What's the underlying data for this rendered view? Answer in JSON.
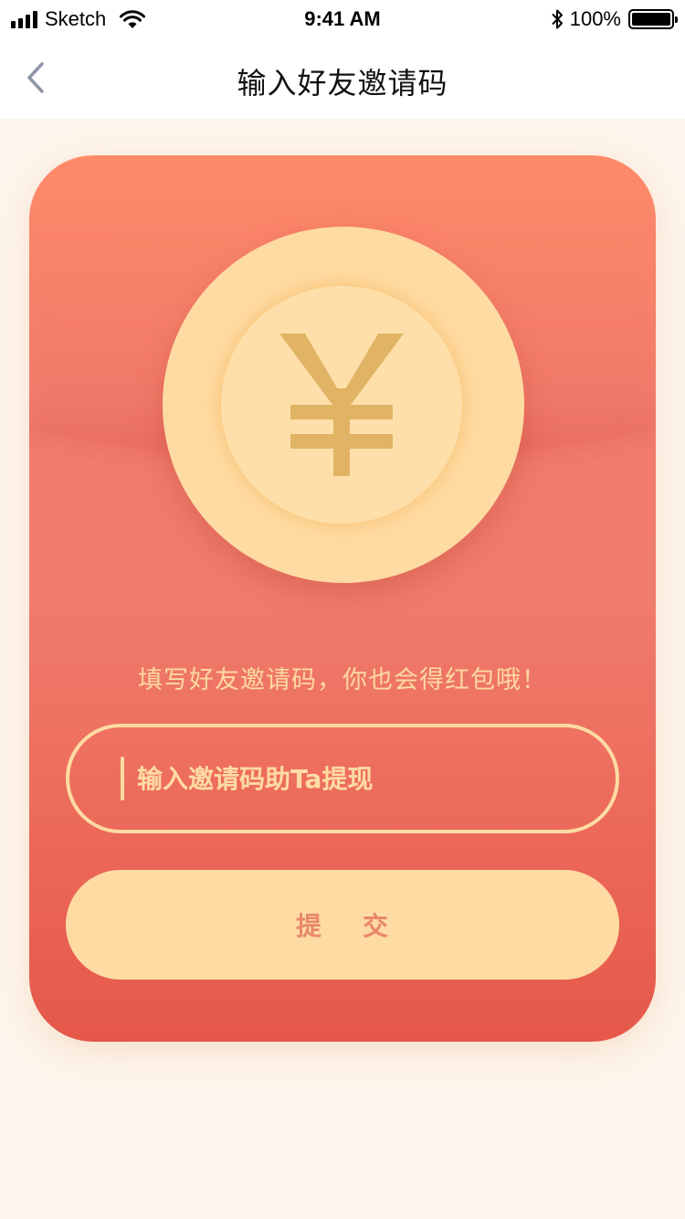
{
  "status_bar": {
    "carrier": "Sketch",
    "time": "9:41 AM",
    "battery_percent": "100%",
    "battery_level": 1.0,
    "icons": [
      "signal-icon",
      "wifi-icon",
      "bluetooth-icon",
      "battery-icon"
    ]
  },
  "nav": {
    "title": "输入好友邀请码",
    "back_icon": "chevron-left-icon"
  },
  "card": {
    "coin_icon": "yen-icon",
    "hint": "填写好友邀请码，你也会得红包哦！",
    "input": {
      "value": "",
      "placeholder": "输入邀请码助Ta提现"
    },
    "submit_label": "提     交"
  },
  "colors": {
    "page_background": "#fdf6ec",
    "card_top": "#ff8b6a",
    "card_bottom": "#e5584a",
    "coin": "#fedba3",
    "yen": "#e0b464",
    "button_text": "#e9876b"
  }
}
